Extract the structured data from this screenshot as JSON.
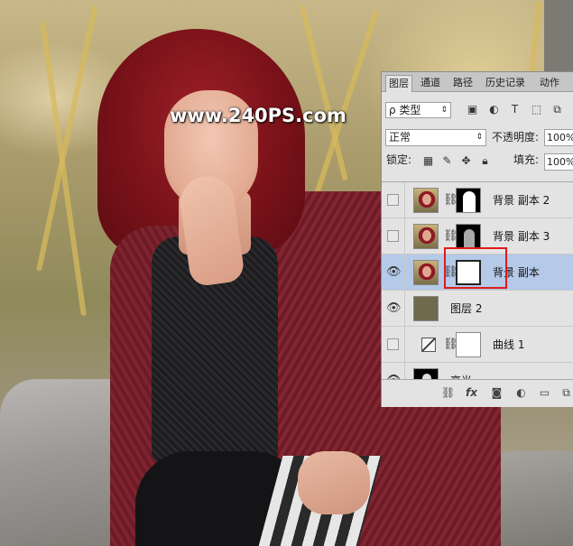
{
  "watermark": "www.240PS.com",
  "panel": {
    "tabs": [
      "图层",
      "通道",
      "路径",
      "历史记录",
      "动作"
    ],
    "active_tab": 0,
    "filter_label": "ρ 类型",
    "blend_mode": "正常",
    "opacity_label": "不透明度:",
    "opacity_value": "100%",
    "lock_label": "锁定:",
    "fill_label": "填充:",
    "fill_value": "100%",
    "layers": [
      {
        "name": "背景 副本 2",
        "visible": false,
        "mask": "shape",
        "selected": false
      },
      {
        "name": "背景 副本 3",
        "visible": false,
        "mask": "shape2",
        "selected": false
      },
      {
        "name": "背景 副本",
        "visible": true,
        "mask": "white",
        "selected": true
      },
      {
        "name": "图层 2",
        "visible": true,
        "mask": "none",
        "selected": false
      },
      {
        "name": "曲线 1",
        "visible": false,
        "mask": "white",
        "selected": false
      },
      {
        "name": "高光",
        "visible": true,
        "mask": "none",
        "selected": false
      }
    ],
    "footer_icons": [
      "link-icon",
      "fx-icon",
      "add-mask-icon",
      "adjustment-icon",
      "folder-icon",
      "new-layer-icon"
    ]
  }
}
